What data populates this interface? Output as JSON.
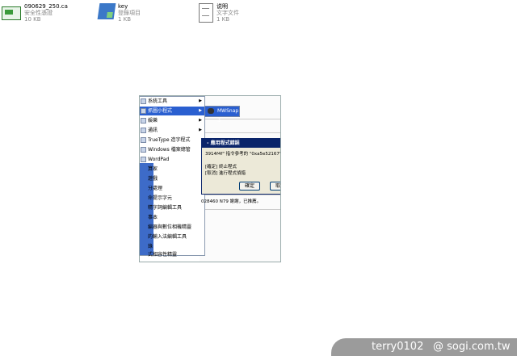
{
  "desktop": {
    "files": [
      {
        "name": "090629_250.ca",
        "type": "安全性憑證",
        "size": "10 KB",
        "icon": "certificate-icon"
      },
      {
        "name": "key",
        "type": "登錄項目",
        "size": "1 KB",
        "icon": "registry-icon"
      },
      {
        "name": "说明",
        "type": "文字文件",
        "size": "1 KB",
        "icon": "text-file-icon"
      }
    ]
  },
  "menu": {
    "items": [
      {
        "label": "系統工具",
        "arrow": "▶"
      },
      {
        "label": "抓圖小程式",
        "arrow": "▶"
      },
      {
        "label": "娛樂",
        "arrow": "▶"
      },
      {
        "label": "通訊",
        "arrow": "▶"
      },
      {
        "label": "TrueType 造字程式",
        "arrow": ""
      },
      {
        "label": "Windows 檔案總管",
        "arrow": ""
      },
      {
        "label": "WordPad",
        "arrow": ""
      },
      {
        "label": "算家",
        "arrow": ""
      },
      {
        "label": "遊戲",
        "arrow": ""
      },
      {
        "label": "分處理",
        "arrow": ""
      },
      {
        "label": "命提示字元",
        "arrow": ""
      },
      {
        "label": "精字詞編輯工具",
        "arrow": ""
      },
      {
        "label": "事本",
        "arrow": ""
      },
      {
        "label": "編器與數位相機精靈",
        "arrow": ""
      },
      {
        "label": "的輸入法編輯工具",
        "arrow": ""
      },
      {
        "label": "錄",
        "arrow": ""
      },
      {
        "label": "式相容性精靈",
        "arrow": ""
      }
    ],
    "submenu": {
      "label": "MWSnap 3"
    }
  },
  "dialog": {
    "title": "- 應用程式錯誤",
    "line1": "3914f4f\" 指令參考的 \"0xa5e52167\" 記",
    "line2": "[確定] 終止程式",
    "line3": "[取消] 進行程式偵錯",
    "ok": "確定",
    "cancel": "取消"
  },
  "background": {
    "line": "028460  N79  謝謝，已推薦。"
  },
  "watermark": {
    "user": "terry0102",
    "site": "@ sogi.com.tw"
  }
}
